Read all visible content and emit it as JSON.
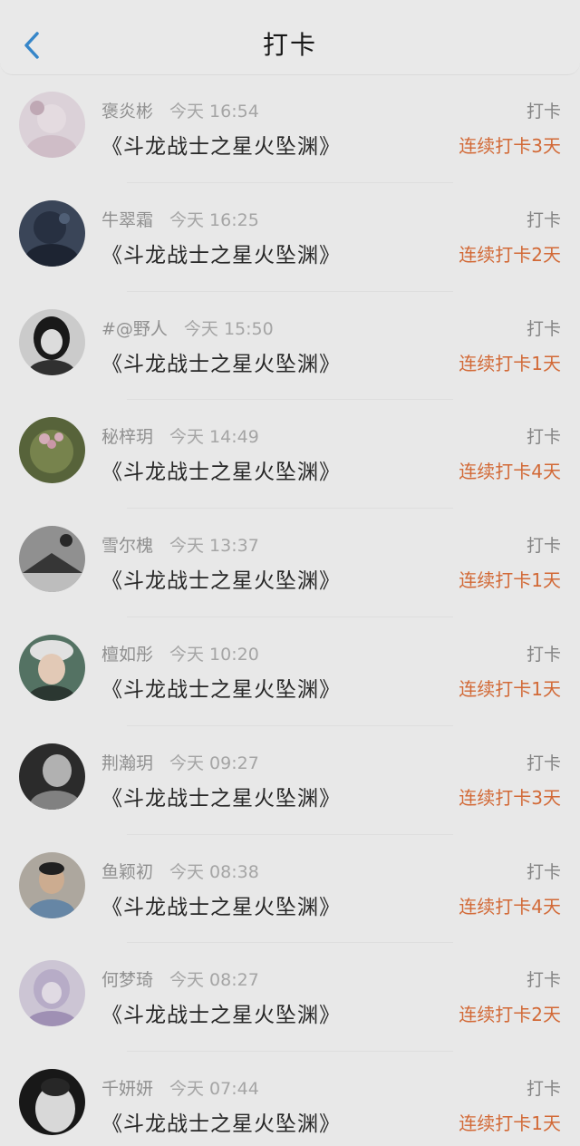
{
  "header": {
    "title": "打卡",
    "back_icon": "chevron-left-icon"
  },
  "colors": {
    "accent_streak": "#e0703a",
    "back_arrow": "#3a8fd6"
  },
  "items": [
    {
      "user": "褒炎彬",
      "time": "今天 16:54",
      "book": "《斗龙战士之星火坠渊》",
      "action": "打卡",
      "streak": "连续打卡3天"
    },
    {
      "user": "牛翠霜",
      "time": "今天 16:25",
      "book": "《斗龙战士之星火坠渊》",
      "action": "打卡",
      "streak": "连续打卡2天"
    },
    {
      "user": "#@野人",
      "time": "今天 15:50",
      "book": "《斗龙战士之星火坠渊》",
      "action": "打卡",
      "streak": "连续打卡1天"
    },
    {
      "user": "秘梓玥",
      "time": "今天 14:49",
      "book": "《斗龙战士之星火坠渊》",
      "action": "打卡",
      "streak": "连续打卡4天"
    },
    {
      "user": "雪尔槐",
      "time": "今天 13:37",
      "book": "《斗龙战士之星火坠渊》",
      "action": "打卡",
      "streak": "连续打卡1天"
    },
    {
      "user": "檀如彤",
      "time": "今天 10:20",
      "book": "《斗龙战士之星火坠渊》",
      "action": "打卡",
      "streak": "连续打卡1天"
    },
    {
      "user": "荆瀚玥",
      "time": "今天 09:27",
      "book": "《斗龙战士之星火坠渊》",
      "action": "打卡",
      "streak": "连续打卡3天"
    },
    {
      "user": "鱼颖初",
      "time": "今天 08:38",
      "book": "《斗龙战士之星火坠渊》",
      "action": "打卡",
      "streak": "连续打卡4天"
    },
    {
      "user": "何梦琦",
      "time": "今天 08:27",
      "book": "《斗龙战士之星火坠渊》",
      "action": "打卡",
      "streak": "连续打卡2天"
    },
    {
      "user": "千妍妍",
      "time": "今天 07:44",
      "book": "《斗龙战士之星火坠渊》",
      "action": "打卡",
      "streak": "连续打卡1天"
    }
  ]
}
